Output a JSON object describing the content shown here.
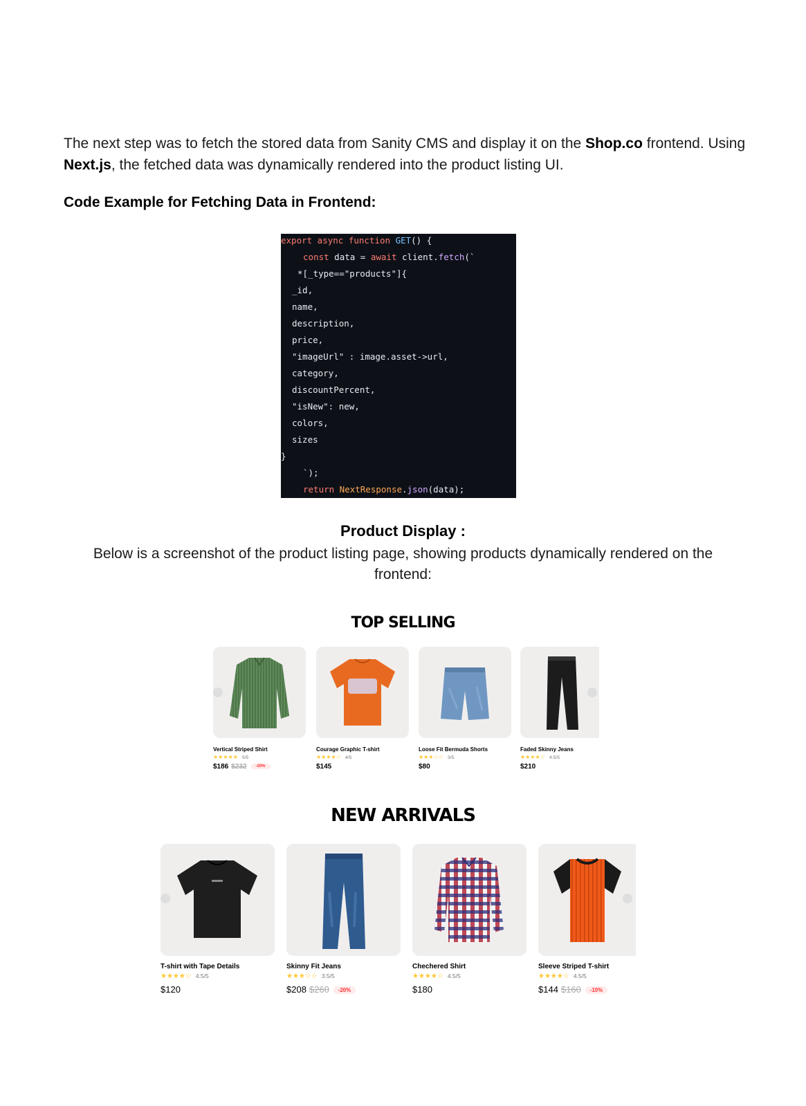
{
  "intro": {
    "p1": "The next step was to fetch the stored data from Sanity CMS and display it on the ",
    "brand": "Shop.co",
    "p2": " frontend. Using ",
    "framework": "Next.js",
    "p3": ", the fetched data was dynamically rendered into the product listing UI."
  },
  "code_heading": "Code Example for Fetching Data in Frontend:",
  "code": {
    "l1_kw": "export async function ",
    "l1_fn": "GET",
    "l1_rest": "() {",
    "l2_kw1": "const",
    "l2_var": " data = ",
    "l2_kw2": "await",
    "l2_obj": " client.",
    "l2_method": "fetch",
    "l2_rest": "(`",
    "l3": "*[_type==\"products\"]{",
    "l4": "_id,",
    "l5": "name,",
    "l6": "description,",
    "l7": "price,",
    "l8": "\"imageUrl\" : image.asset->url,",
    "l9": "category,",
    "l10": "discountPercent,",
    "l11": "\"isNew\": new,",
    "l12": "colors,",
    "l13": "sizes",
    "l14": "}",
    "l15": "`);",
    "l16_kw": "return",
    "l16_cls": " NextResponse",
    "l16_dot": ".",
    "l16_method": "json",
    "l16_rest": "(data);"
  },
  "display": {
    "title": "Product Display :",
    "text": "Below is a screenshot of the product listing page, showing products dynamically rendered on the frontend:"
  },
  "top_selling": {
    "title": "TOP SELLING",
    "products": [
      {
        "name": "Vertical Striped Shirt",
        "stars": "★★★★★",
        "rating": "5/5",
        "price": "$186",
        "old_price": "$232",
        "discount": "-20%"
      },
      {
        "name": "Courage Graphic T-shirt",
        "stars": "★★★★☆",
        "rating": "4/5",
        "price": "$145",
        "old_price": "",
        "discount": ""
      },
      {
        "name": "Loose Fit Bermuda Shorts",
        "stars": "★★★☆☆",
        "rating": "3/5",
        "price": "$80",
        "old_price": "",
        "discount": ""
      },
      {
        "name": "Faded Skinny Jeans",
        "stars": "★★★★☆",
        "rating": "4.5/5",
        "price": "$210",
        "old_price": "",
        "discount": ""
      }
    ]
  },
  "new_arrivals": {
    "title": "NEW ARRIVALS",
    "products": [
      {
        "name": "T-shirt with Tape Details",
        "stars": "★★★★☆",
        "rating": "4.5/5",
        "price": "$120",
        "old_price": "",
        "discount": ""
      },
      {
        "name": "Skinny Fit Jeans",
        "stars": "★★★☆☆",
        "rating": "3.5/5",
        "price": "$208",
        "old_price": "$260",
        "discount": "-20%"
      },
      {
        "name": "Chechered Shirt",
        "stars": "★★★★☆",
        "rating": "4.5/5",
        "price": "$180",
        "old_price": "",
        "discount": ""
      },
      {
        "name": "Sleeve Striped T-shirt",
        "stars": "★★★★☆",
        "rating": "4.5/5",
        "price": "$144",
        "old_price": "$160",
        "discount": "-10%"
      }
    ]
  },
  "colors": {
    "code_bg": "#0d1117",
    "card_bg": "#f0eeed",
    "star": "#ffc633",
    "discount": "#ff3333"
  }
}
